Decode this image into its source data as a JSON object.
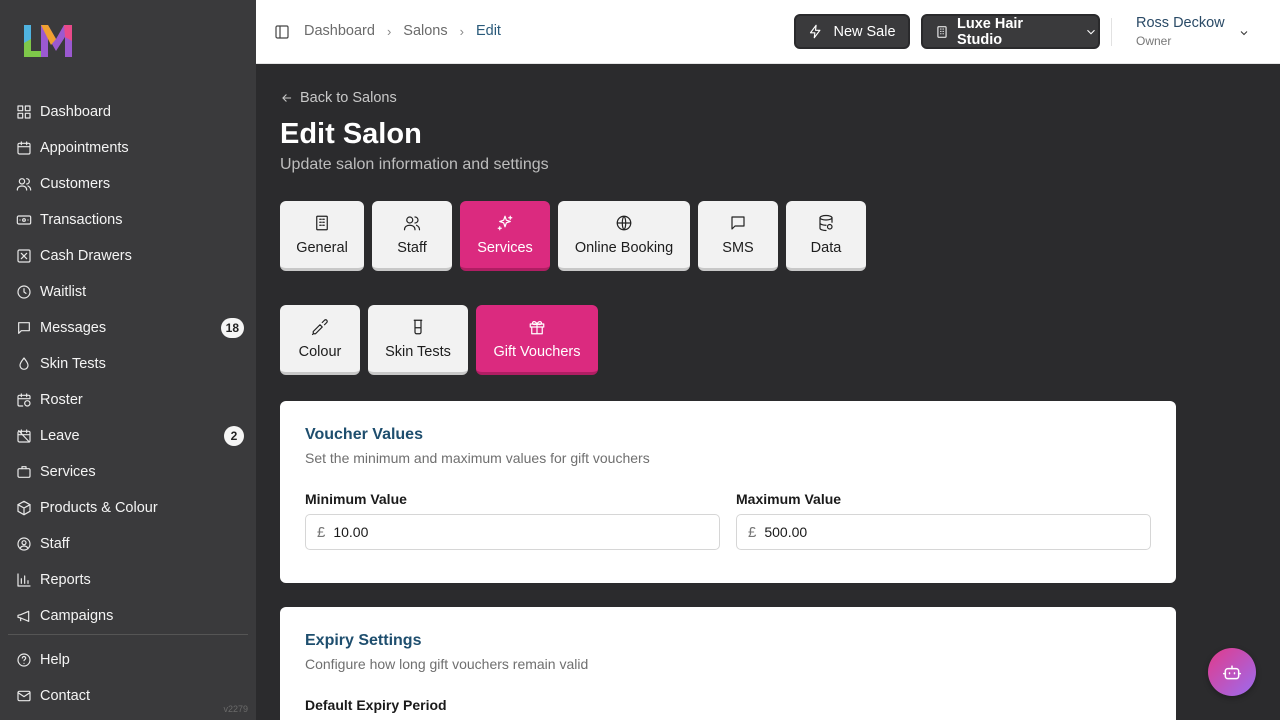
{
  "sidebar": {
    "items": [
      {
        "label": "Dashboard",
        "icon": "dashboard-icon"
      },
      {
        "label": "Appointments",
        "icon": "calendar-icon"
      },
      {
        "label": "Customers",
        "icon": "users-icon"
      },
      {
        "label": "Transactions",
        "icon": "banknote-icon"
      },
      {
        "label": "Cash Drawers",
        "icon": "cash-drawer-icon"
      },
      {
        "label": "Waitlist",
        "icon": "clock-icon"
      },
      {
        "label": "Messages",
        "icon": "message-icon",
        "badge": "18"
      },
      {
        "label": "Skin Tests",
        "icon": "droplet-icon"
      },
      {
        "label": "Roster",
        "icon": "calendar-clock-icon"
      },
      {
        "label": "Leave",
        "icon": "calendar-off-icon",
        "badge": "2"
      },
      {
        "label": "Services",
        "icon": "briefcase-icon"
      },
      {
        "label": "Products & Colour",
        "icon": "package-icon"
      },
      {
        "label": "Staff",
        "icon": "user-circle-icon"
      },
      {
        "label": "Reports",
        "icon": "bar-chart-icon"
      },
      {
        "label": "Campaigns",
        "icon": "megaphone-icon"
      }
    ],
    "bottom_items": [
      {
        "label": "Help",
        "icon": "help-circle-icon"
      },
      {
        "label": "Contact",
        "icon": "mail-icon"
      }
    ],
    "version": "v2279"
  },
  "header": {
    "breadcrumb": [
      "Dashboard",
      "Salons",
      "Edit"
    ],
    "new_sale_label": "New Sale",
    "salon_label": "Luxe Hair Studio",
    "user_name": "Ross Deckow",
    "user_role": "Owner"
  },
  "page": {
    "back_label": "Back to Salons",
    "title": "Edit Salon",
    "subtitle": "Update salon information and settings"
  },
  "tabs_row1": [
    {
      "label": "General",
      "icon": "building-icon",
      "active": false
    },
    {
      "label": "Staff",
      "icon": "users-icon",
      "active": false
    },
    {
      "label": "Services",
      "icon": "sparkles-icon",
      "active": true
    },
    {
      "label": "Online Booking",
      "icon": "globe-icon",
      "active": false
    },
    {
      "label": "SMS",
      "icon": "message-square-icon",
      "active": false
    },
    {
      "label": "Data",
      "icon": "database-icon",
      "active": false
    }
  ],
  "tabs_row2": [
    {
      "label": "Colour",
      "icon": "pipette-icon",
      "active": false
    },
    {
      "label": "Skin Tests",
      "icon": "test-tube-icon",
      "active": false
    },
    {
      "label": "Gift Vouchers",
      "icon": "gift-icon",
      "active": true
    }
  ],
  "voucher_values": {
    "title": "Voucher Values",
    "subtitle": "Set the minimum and maximum values for gift vouchers",
    "min_label": "Minimum Value",
    "min_value": "10.00",
    "max_label": "Maximum Value",
    "max_value": "500.00",
    "currency": "£"
  },
  "expiry": {
    "title": "Expiry Settings",
    "subtitle": "Configure how long gift vouchers remain valid",
    "period_label": "Default Expiry Period"
  },
  "colors": {
    "accent": "#db2a7f",
    "sidebar_bg": "#3a3a3c",
    "content_bg": "#2b2b2d"
  }
}
